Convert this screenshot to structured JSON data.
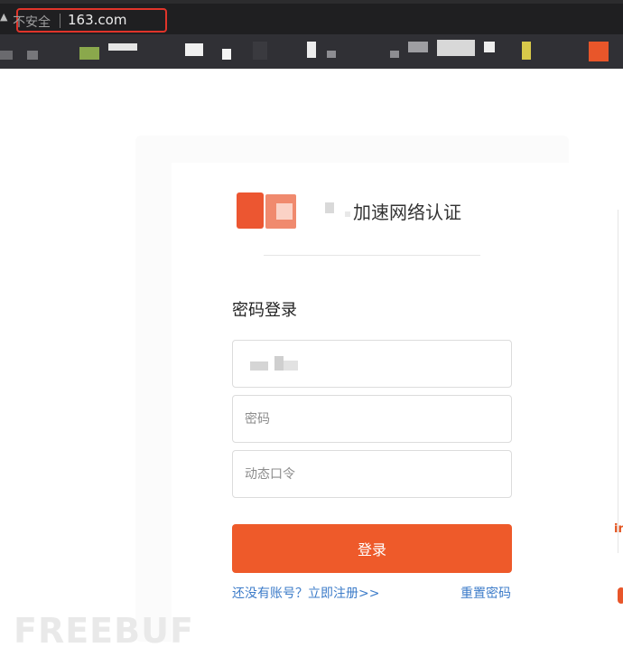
{
  "browser": {
    "security_label": "不安全",
    "url": "163.com",
    "warning_icon": "warning-triangle-icon"
  },
  "brand": {
    "title": "加速网络认证"
  },
  "login": {
    "heading": "密码登录",
    "password_placeholder": "密码",
    "otp_placeholder": "动态口令",
    "submit_label": "登录",
    "register_link": "还没有账号？立即注册>>",
    "reset_link": "重置密码"
  },
  "side_fragment": {
    "text": "in"
  },
  "colors": {
    "accent": "#ee5a2a",
    "link": "#3d7cc9",
    "chrome_bar": "#1f1f21",
    "address_highlight": "#e0342a"
  }
}
